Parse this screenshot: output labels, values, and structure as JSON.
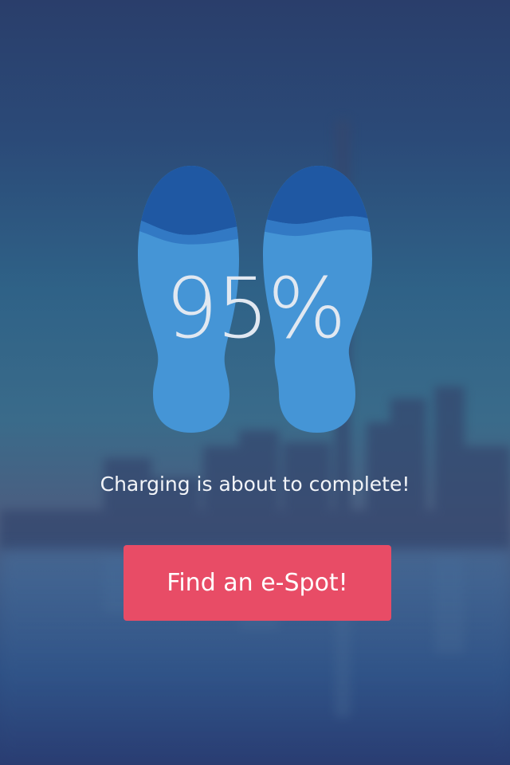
{
  "charge": {
    "percent_label": "95%",
    "level": 0.95
  },
  "status": {
    "message": "Charging is about to complete!"
  },
  "actions": {
    "find_spot_label": "Find an e-Spot!"
  },
  "colors": {
    "accent": "#e84c66",
    "footprint_light": "#4595d6",
    "footprint_dark": "#1f58a3",
    "background_top": "#2a3e6b",
    "background_bottom": "#2a3d72"
  },
  "icons": {
    "footprints": "footprints-icon"
  }
}
